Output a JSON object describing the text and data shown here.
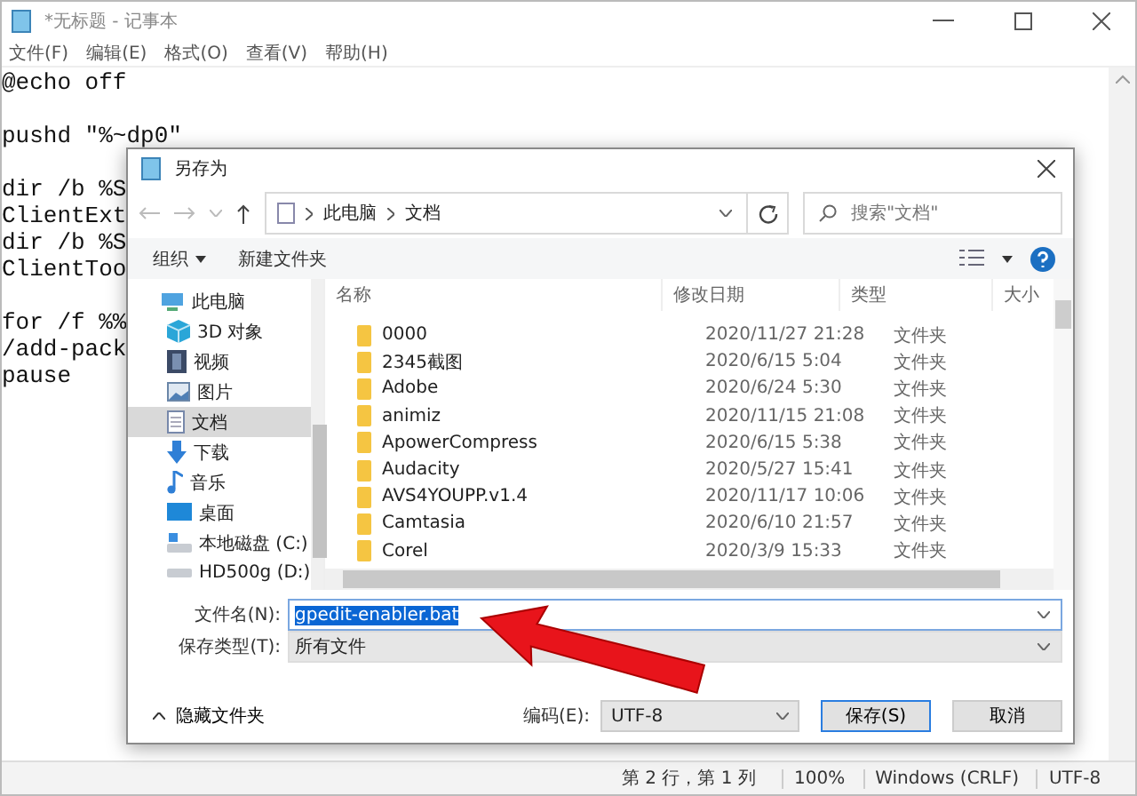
{
  "window": {
    "title": "*无标题 - 记事本"
  },
  "menu": [
    "文件(F)",
    "编辑(E)",
    "格式(O)",
    "查看(V)",
    "帮助(H)"
  ],
  "editor": {
    "blocks": [
      [
        "@echo off"
      ],
      [
        "pushd \"%~dp0\""
      ],
      [
        "dir /b %S",
        "ClientExt",
        "dir /b %S",
        "ClientToo"
      ],
      [
        "for /f %%",
        "/add-pack",
        "pause"
      ]
    ]
  },
  "status_bar": [
    "第 2 行，第 1 列",
    "100%",
    "Windows (CRLF)",
    "UTF-8"
  ],
  "dialog": {
    "title": "另存为",
    "address": [
      "此电脑",
      "文档"
    ],
    "search": {
      "placeholder": "搜索\"文档\""
    },
    "toolbar": {
      "organize": "组织",
      "new_folder": "新建文件夹"
    },
    "nav_tree": [
      {
        "label": "此电脑",
        "kind": "computer",
        "selected": false,
        "children": [
          {
            "label": "3D 对象",
            "kind": "cube",
            "selected": false
          },
          {
            "label": "视频",
            "kind": "video",
            "selected": false
          },
          {
            "label": "图片",
            "kind": "picture",
            "selected": false
          },
          {
            "label": "文档",
            "kind": "document",
            "selected": true
          },
          {
            "label": "下载",
            "kind": "download",
            "selected": false
          },
          {
            "label": "音乐",
            "kind": "music",
            "selected": false
          },
          {
            "label": "桌面",
            "kind": "desktop",
            "selected": false
          },
          {
            "label": "本地磁盘 (C:)",
            "kind": "system-drive",
            "selected": false
          },
          {
            "label": "HD500g (D:)",
            "kind": "drive",
            "selected": false
          }
        ]
      }
    ],
    "columns": [
      "名称",
      "修改日期",
      "类型",
      "大小"
    ],
    "rows": [
      {
        "name": "0000",
        "modified": "2020/11/27 21:28",
        "type": "文件夹"
      },
      {
        "name": "2345截图",
        "modified": "2020/6/15 5:04",
        "type": "文件夹"
      },
      {
        "name": "Adobe",
        "modified": "2020/6/24 5:30",
        "type": "文件夹"
      },
      {
        "name": "animiz",
        "modified": "2020/11/15 21:08",
        "type": "文件夹"
      },
      {
        "name": "ApowerCompress",
        "modified": "2020/6/15 5:38",
        "type": "文件夹"
      },
      {
        "name": "Audacity",
        "modified": "2020/5/27 15:41",
        "type": "文件夹"
      },
      {
        "name": "AVS4YOUPP.v1.4",
        "modified": "2020/11/17 10:06",
        "type": "文件夹"
      },
      {
        "name": "Camtasia",
        "modified": "2020/6/10 21:57",
        "type": "文件夹"
      },
      {
        "name": "Corel",
        "modified": "2020/3/9 15:33",
        "type": "文件夹"
      }
    ],
    "filename": {
      "label": "文件名(N):",
      "value": "gpedit-enabler.bat",
      "selected": true
    },
    "filetype": {
      "label": "保存类型(T):",
      "value": "所有文件"
    },
    "hide_folders": "隐藏文件夹",
    "encoding": {
      "label": "编码(E):",
      "value": "UTF-8"
    },
    "buttons": [
      {
        "label": "保存(S)",
        "kind": "primary"
      },
      {
        "label": "取消",
        "kind": "normal"
      }
    ]
  }
}
